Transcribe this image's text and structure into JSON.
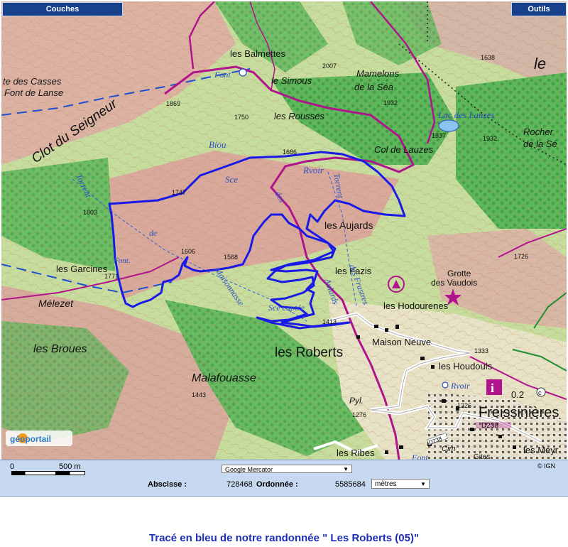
{
  "toolbar": {
    "left_button": "Couches",
    "right_button": "Outils"
  },
  "map": {
    "labels": {
      "balmettes": "les Balmettes",
      "alt_2007": "2007",
      "mamelons": "Mamelons",
      "de_la_sea": "de la Séa",
      "alt_1932a": "1932",
      "alt_1638": "1638",
      "le": "le",
      "te_des_casses": "te des Casses",
      "font_de_lanse": "Font de Lanse",
      "alt_1869": "1869",
      "font": "Font",
      "le_simous": "le Simous",
      "alt_1750": "1750",
      "les_rousses": "les Rousses",
      "lac_des_lauzes": "Lac des Lauzes",
      "alt_1837": "1837",
      "alt_1932b": "1932",
      "rocher": "Rocher",
      "de_la_se": "de la Sé",
      "clot_du_seigneur": "Clot du Seigneur",
      "biou": "Biou",
      "alt_1686": "1686",
      "col_de_lauzes": "Col de Lauzes",
      "sce_1": "Sce",
      "rvoir_1": "Rvoir",
      "des": "des",
      "torrent_left": "Torrent",
      "torrent_mid": "Torrent",
      "alt_1747": "1747",
      "alt_1803": "1803",
      "les_aujards": "les Aujards",
      "alt_1726": "1726",
      "de_left": "de",
      "alt_1606": "1606",
      "alt_1568": "1568",
      "les_garcines": "les Garcines",
      "alt_1771": "1771",
      "fontaine": "Font.",
      "maisonnasse": "Maisonnasse",
      "les_fazis": "les Fazis",
      "grotte": "Grotte",
      "des_vaudois": "des Vaudois",
      "melezet": "Mélezet",
      "sce_captee": "Sce captée",
      "aulards": "Aulards",
      "des_frastres": "des Frastres",
      "alt_1413": "1413",
      "les_hodourenes": "les Hodourenes",
      "les_broues": "les Broues",
      "les_roberts": "les Roberts",
      "maison_neuve": "Maison Neuve",
      "alt_1333": "1333",
      "les_houdouls": "les Houdouls",
      "malafouasse": "Malafouasse",
      "rvoir_2": "Rvoir",
      "alt_1443": "1443",
      "pyl": "Pyl.",
      "alt_1276": "1276",
      "alt_1226": "1226",
      "freissinieres": "Freissinières",
      "info_0_2": "0.2",
      "d238_a": "D238",
      "d238_b": "D238",
      "cim": "Cim",
      "les_ribes": "les Ribes",
      "font_bottom": "Font",
      "gites": "Gites",
      "les_meyr": "les Meyr"
    },
    "logo_text": "géoportail",
    "copyright": "© IGN"
  },
  "bottom_bar": {
    "scale_zero": "0",
    "scale_distance": "500 m",
    "projection": "Google Mercator",
    "abscisse_label": "Abscisse :",
    "abscisse_value": "728468",
    "ordonnee_label": "Ordonnée :",
    "ordonnee_value": "5585684",
    "unit": "mètres"
  },
  "caption": "Tracé en bleu de notre randonnée \" Les Roberts (05)\"",
  "colors": {
    "toolbar": "#17418b",
    "bottom_bar": "#c6d9f1",
    "hike_track": "#1a1ae6",
    "road_magenta": "#b0148c",
    "forest": "#39a84a",
    "relief": "#d8a9a0",
    "caption": "#1c2db3"
  }
}
